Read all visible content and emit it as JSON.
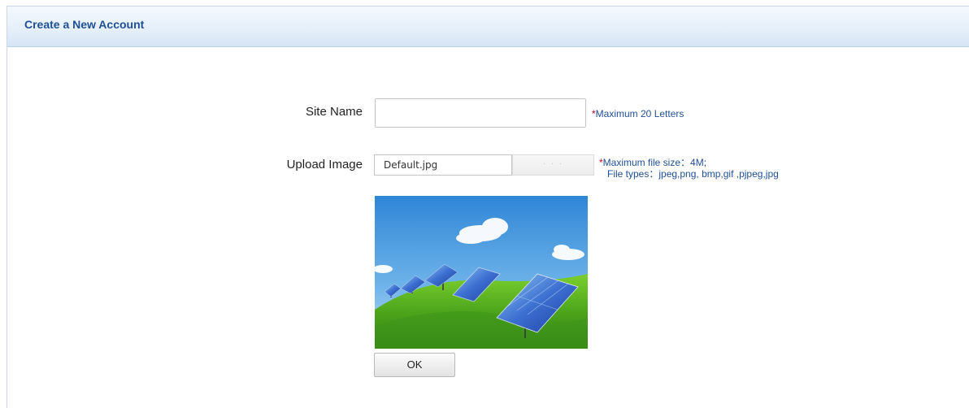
{
  "header": {
    "title": "Create a New Account"
  },
  "form": {
    "site_name_label": "Site Name",
    "site_name_value": "",
    "site_name_hint_star": "*",
    "site_name_hint": "Maximum 20 Letters",
    "upload_label": "Upload Image",
    "upload_file_value": "Default.jpg",
    "browse_label": "· · ·",
    "upload_hint_star": "*",
    "upload_hint_line1": "Maximum file size：4M;",
    "upload_hint_line2": "File types：jpeg,png, bmp,gif ,pjpeg,jpg",
    "ok_label": "OK"
  },
  "colors": {
    "header_text": "#1f4f95",
    "hint_text": "#1f4f95",
    "required_star": "#d0021b",
    "header_bg": "#e6f0fa"
  },
  "preview_image": {
    "icon": "solar-panels-on-hill-image"
  }
}
